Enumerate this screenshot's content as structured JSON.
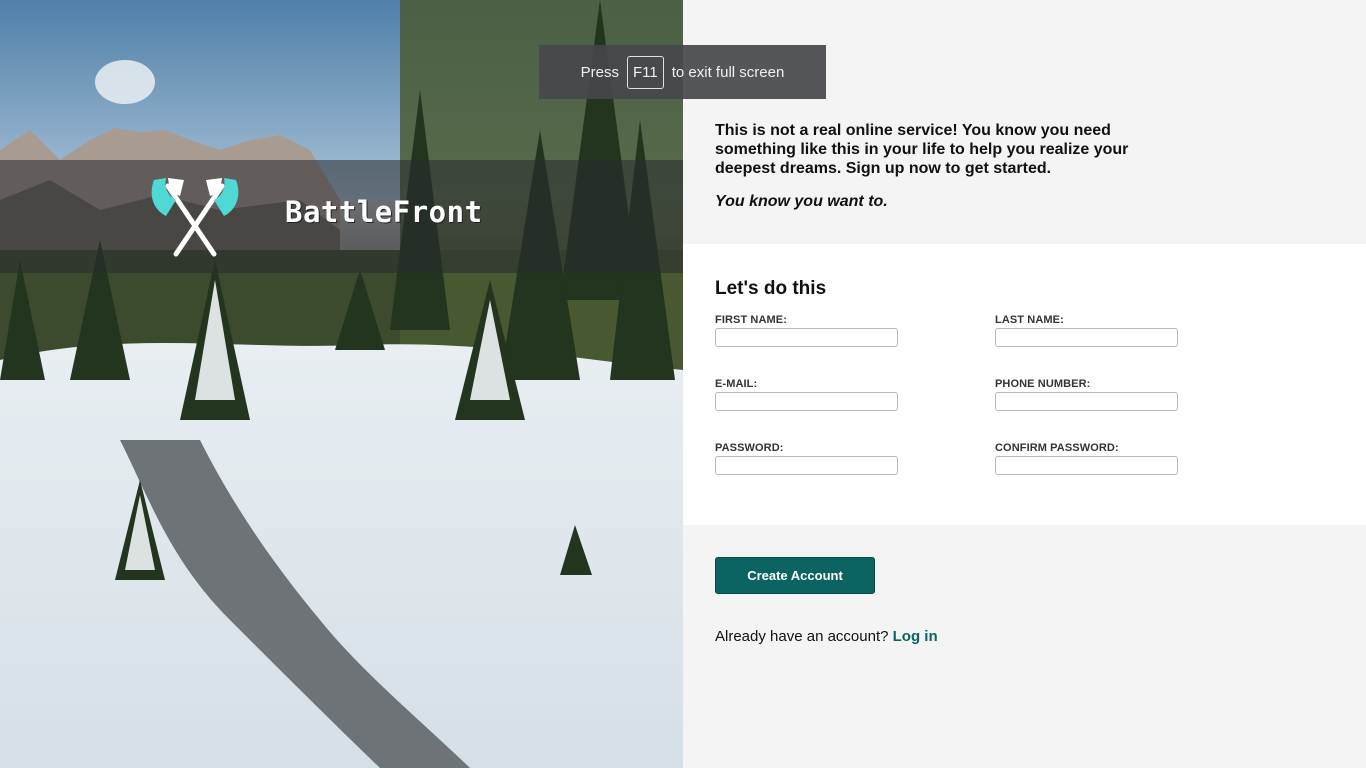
{
  "toast": {
    "prefix": "Press",
    "key": "F11",
    "suffix": "to exit full screen"
  },
  "brand": {
    "name": "BattleFront",
    "logo_icon": "crossed-axes-icon"
  },
  "intro": {
    "text": "This is not a real online service! You know you need something like this in your life to help you realize your deepest dreams. Sign up now to get started.",
    "emphasis": "You know you want to."
  },
  "form": {
    "title": "Let's do this",
    "first_name": {
      "label": "FIRST NAME:",
      "value": ""
    },
    "last_name": {
      "label": "LAST NAME:",
      "value": ""
    },
    "email": {
      "label": "E-MAIL:",
      "value": ""
    },
    "phone": {
      "label": "PHONE NUMBER:",
      "value": ""
    },
    "password": {
      "label": "PASSWORD:",
      "value": ""
    },
    "confirm_password": {
      "label": "CONFIRM PASSWORD:",
      "value": ""
    }
  },
  "actions": {
    "create_label": "Create Account",
    "login_prompt": "Already have an account?",
    "login_link": "Log in"
  },
  "colors": {
    "accent": "#0b6461",
    "logo": "#4fd8d4",
    "panel_bg": "#f4f4f4"
  }
}
